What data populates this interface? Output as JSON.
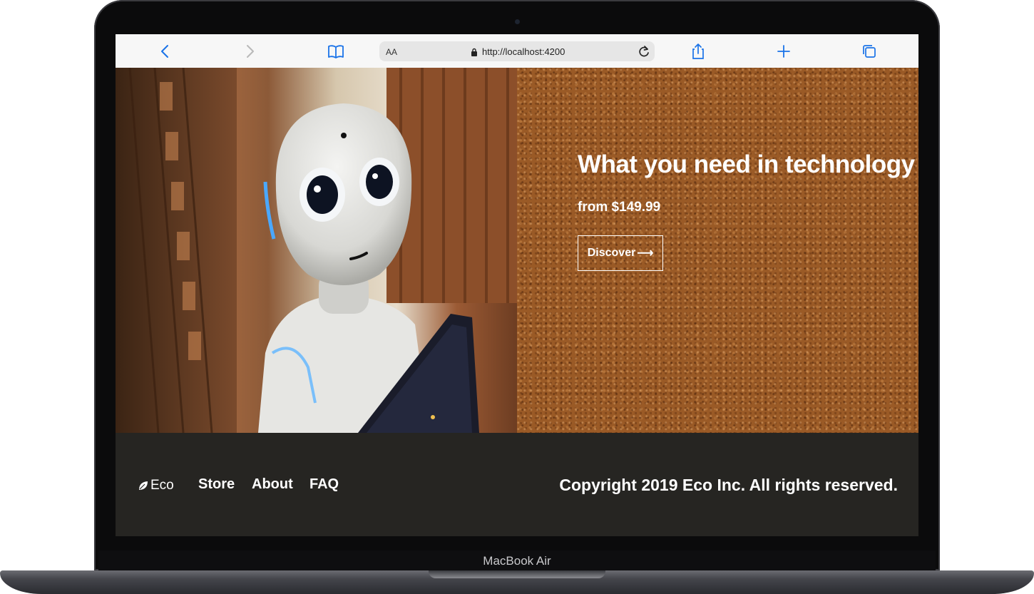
{
  "device": {
    "model_label": "MacBook Air"
  },
  "browser": {
    "text_size_button": "AA",
    "url": "http://localhost:4200",
    "icons": [
      "back-icon",
      "forward-icon",
      "bookmarks-icon",
      "lock-icon",
      "reload-icon",
      "share-icon",
      "new-tab-icon",
      "tabs-icon"
    ]
  },
  "hero": {
    "headline": "What you need in technology",
    "price": "from $149.99",
    "cta_label": "Discover",
    "cta_arrow": "⟶",
    "image_subject": "white humanoid robot holding a tablet"
  },
  "footer": {
    "brand": "Eco",
    "nav": [
      "Store",
      "About",
      "FAQ"
    ],
    "copyright": "Copyright 2019 Eco Inc. All rights reserved."
  },
  "colors": {
    "browser_accent": "#1a73e8",
    "footer_bg": "#262522",
    "cork": "#9a5a26",
    "text": "#ffffff"
  }
}
